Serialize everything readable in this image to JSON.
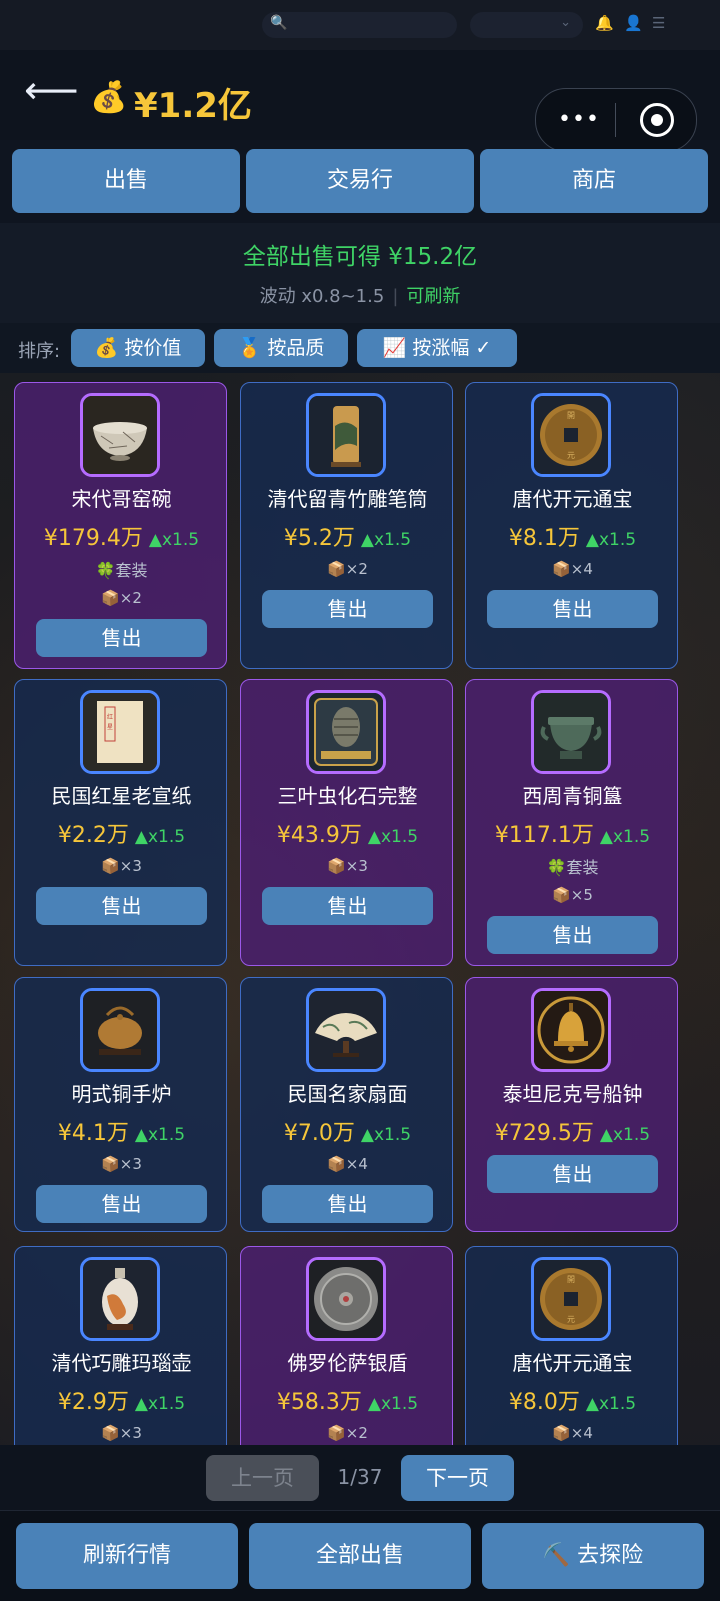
{
  "topbar": {
    "search_icon": "search-icon",
    "select_caret": "⌄"
  },
  "header": {
    "back_arrow": "⟵",
    "money_icon": "💰",
    "money": "¥1.2亿"
  },
  "tabs": [
    {
      "label": "出售"
    },
    {
      "label": "交易行"
    },
    {
      "label": "商店"
    }
  ],
  "summary": {
    "main": "全部出售可得 ¥15.2亿",
    "volatility": "波动 x0.8~1.5",
    "separator": "|",
    "refresh": "可刷新"
  },
  "sort": {
    "label": "排序:",
    "options": [
      {
        "label": "💰 按价值"
      },
      {
        "label": "🏅 按品质"
      },
      {
        "label": "📈 按涨幅 ✓"
      }
    ]
  },
  "items": [
    {
      "name": "宋代哥窑碗",
      "price": "¥179.4万",
      "mult": "▲x1.5",
      "set": "🍀套装",
      "qty": "📦×2",
      "rarity": "purple",
      "sell": "售出"
    },
    {
      "name": "清代留青竹雕笔筒",
      "price": "¥5.2万",
      "mult": "▲x1.5",
      "set": "",
      "qty": "📦×2",
      "rarity": "blue",
      "sell": "售出"
    },
    {
      "name": "唐代开元通宝",
      "price": "¥8.1万",
      "mult": "▲x1.5",
      "set": "",
      "qty": "📦×4",
      "rarity": "blue",
      "sell": "售出"
    },
    {
      "name": "民国红星老宣纸",
      "price": "¥2.2万",
      "mult": "▲x1.5",
      "set": "",
      "qty": "📦×3",
      "rarity": "blue",
      "sell": "售出"
    },
    {
      "name": "三叶虫化石完整",
      "price": "¥43.9万",
      "mult": "▲x1.5",
      "set": "",
      "qty": "📦×3",
      "rarity": "purple",
      "sell": "售出"
    },
    {
      "name": "西周青铜簋",
      "price": "¥117.1万",
      "mult": "▲x1.5",
      "set": "🍀套装",
      "qty": "📦×5",
      "rarity": "purple",
      "sell": "售出"
    },
    {
      "name": "明式铜手炉",
      "price": "¥4.1万",
      "mult": "▲x1.5",
      "set": "",
      "qty": "📦×3",
      "rarity": "blue",
      "sell": "售出"
    },
    {
      "name": "民国名家扇面",
      "price": "¥7.0万",
      "mult": "▲x1.5",
      "set": "",
      "qty": "📦×4",
      "rarity": "blue",
      "sell": "售出"
    },
    {
      "name": "泰坦尼克号船钟",
      "price": "¥729.5万",
      "mult": "▲x1.5",
      "set": "",
      "qty": "",
      "rarity": "purple",
      "sell": "售出"
    },
    {
      "name": "清代巧雕玛瑙壶",
      "price": "¥2.9万",
      "mult": "▲x1.5",
      "set": "",
      "qty": "📦×3",
      "rarity": "blue",
      "sell": ""
    },
    {
      "name": "佛罗伦萨银盾",
      "price": "¥58.3万",
      "mult": "▲x1.5",
      "set": "",
      "qty": "📦×2",
      "rarity": "purple",
      "sell": ""
    },
    {
      "name": "唐代开元通宝",
      "price": "¥8.0万",
      "mult": "▲x1.5",
      "set": "",
      "qty": "📦×4",
      "rarity": "blue",
      "sell": ""
    }
  ],
  "pager": {
    "prev": "上一页",
    "page": "1/37",
    "next": "下一页"
  },
  "bottom": {
    "refresh": "刷新行情",
    "sell_all": "全部出售",
    "explore": "⛏️ 去探险"
  }
}
